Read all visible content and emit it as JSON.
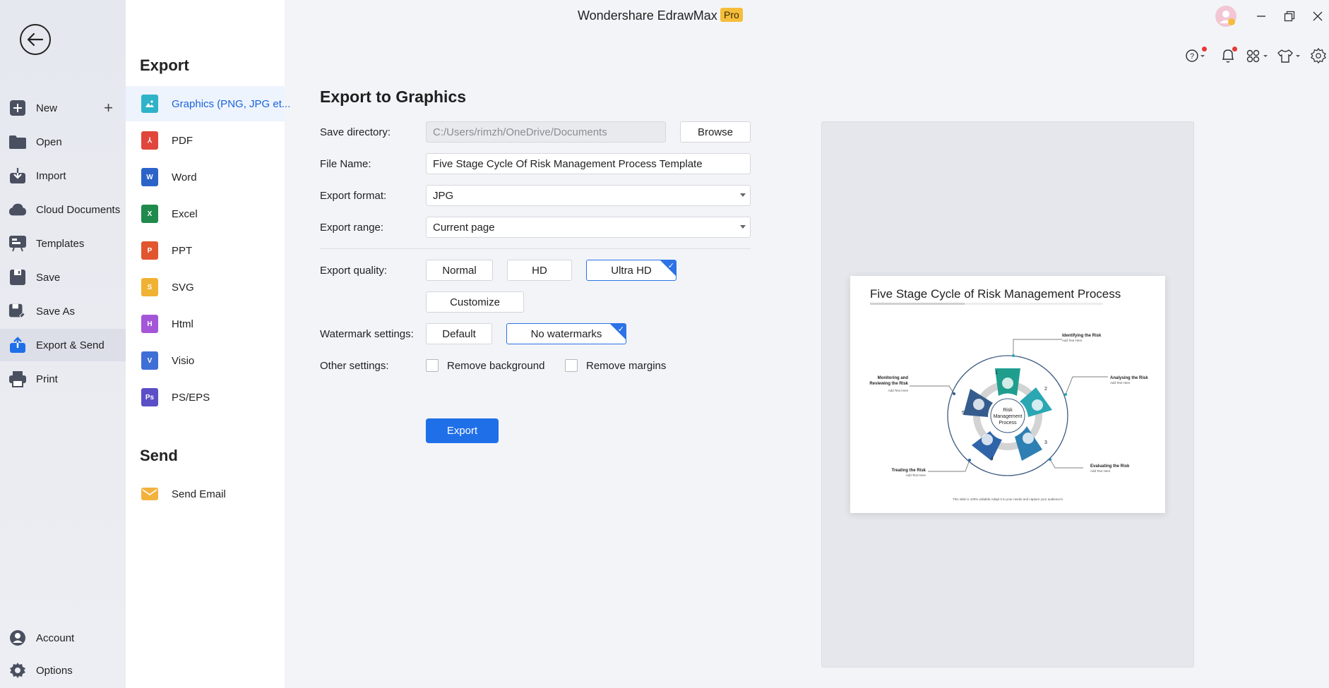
{
  "sidebar": {
    "items": [
      {
        "label": "New",
        "icon": "plus-square-icon"
      },
      {
        "label": "Open",
        "icon": "folder-icon"
      },
      {
        "label": "Import",
        "icon": "import-icon"
      },
      {
        "label": "Cloud Documents",
        "icon": "cloud-icon"
      },
      {
        "label": "Templates",
        "icon": "templates-icon"
      },
      {
        "label": "Save",
        "icon": "save-icon"
      },
      {
        "label": "Save As",
        "icon": "save-as-icon"
      },
      {
        "label": "Export & Send",
        "icon": "export-icon"
      },
      {
        "label": "Print",
        "icon": "print-icon"
      }
    ],
    "bottom": [
      {
        "label": "Account",
        "icon": "account-icon"
      },
      {
        "label": "Options",
        "icon": "gear-icon"
      }
    ]
  },
  "menu": {
    "export_heading": "Export",
    "export_items": [
      {
        "label": "Graphics (PNG, JPG et...",
        "icon": "image-file-icon",
        "color": "#2fb3c9"
      },
      {
        "label": "PDF",
        "icon": "pdf-file-icon",
        "color": "#e0463b"
      },
      {
        "label": "Word",
        "icon": "word-file-icon",
        "color": "#2b63c9"
      },
      {
        "label": "Excel",
        "icon": "excel-file-icon",
        "color": "#1f8a4c"
      },
      {
        "label": "PPT",
        "icon": "ppt-file-icon",
        "color": "#e2562f"
      },
      {
        "label": "SVG",
        "icon": "svg-file-icon",
        "color": "#f0b232"
      },
      {
        "label": "Html",
        "icon": "html-file-icon",
        "color": "#a456d8"
      },
      {
        "label": "Visio",
        "icon": "visio-file-icon",
        "color": "#3f6fd6"
      },
      {
        "label": "PS/EPS",
        "icon": "ps-file-icon",
        "color": "#5b4fc7"
      }
    ],
    "send_heading": "Send",
    "send_items": [
      {
        "label": "Send Email",
        "icon": "email-icon",
        "color": "#f3b23e"
      }
    ]
  },
  "titlebar": {
    "app_title": "Wondershare EdrawMax",
    "badge": "Pro"
  },
  "form": {
    "title": "Export to Graphics",
    "save_directory_label": "Save directory:",
    "save_directory_value": "C:/Users/rimzh/OneDrive/Documents",
    "browse_label": "Browse",
    "file_name_label": "File Name:",
    "file_name_value": "Five Stage Cycle Of Risk Management Process Template",
    "export_format_label": "Export format:",
    "export_format_value": "JPG",
    "export_range_label": "Export range:",
    "export_range_value": "Current page",
    "export_quality_label": "Export quality:",
    "quality_options": [
      "Normal",
      "HD",
      "Ultra HD"
    ],
    "quality_selected": "Ultra HD",
    "customize_label": "Customize",
    "watermark_label": "Watermark settings:",
    "watermark_options": [
      "Default",
      "No watermarks"
    ],
    "watermark_selected": "No watermarks",
    "other_settings_label": "Other settings:",
    "remove_background_label": "Remove background",
    "remove_margins_label": "Remove margins",
    "export_button": "Export"
  },
  "preview": {
    "title": "Five Stage Cycle of Risk Management Process",
    "center_label": [
      "Risk",
      "Management",
      "Process"
    ],
    "stages": [
      {
        "num": "1",
        "title": "Identifying the Risk",
        "sub": "Add Text Here"
      },
      {
        "num": "2",
        "title": "Analysing the Risk",
        "sub": "Add Text Here"
      },
      {
        "num": "3",
        "title": "Evaluating the Risk",
        "sub": "Add Text Here"
      },
      {
        "num": "4",
        "title": "Treating the Risk",
        "sub": "Add Text Here"
      },
      {
        "num": "5",
        "title": "Monitoring and",
        "title2": "Reviewing the Risk",
        "sub": "Add Text Here"
      }
    ],
    "footer": "This slide is 100% editable.Adapt it to your needs and capture your audience's"
  }
}
